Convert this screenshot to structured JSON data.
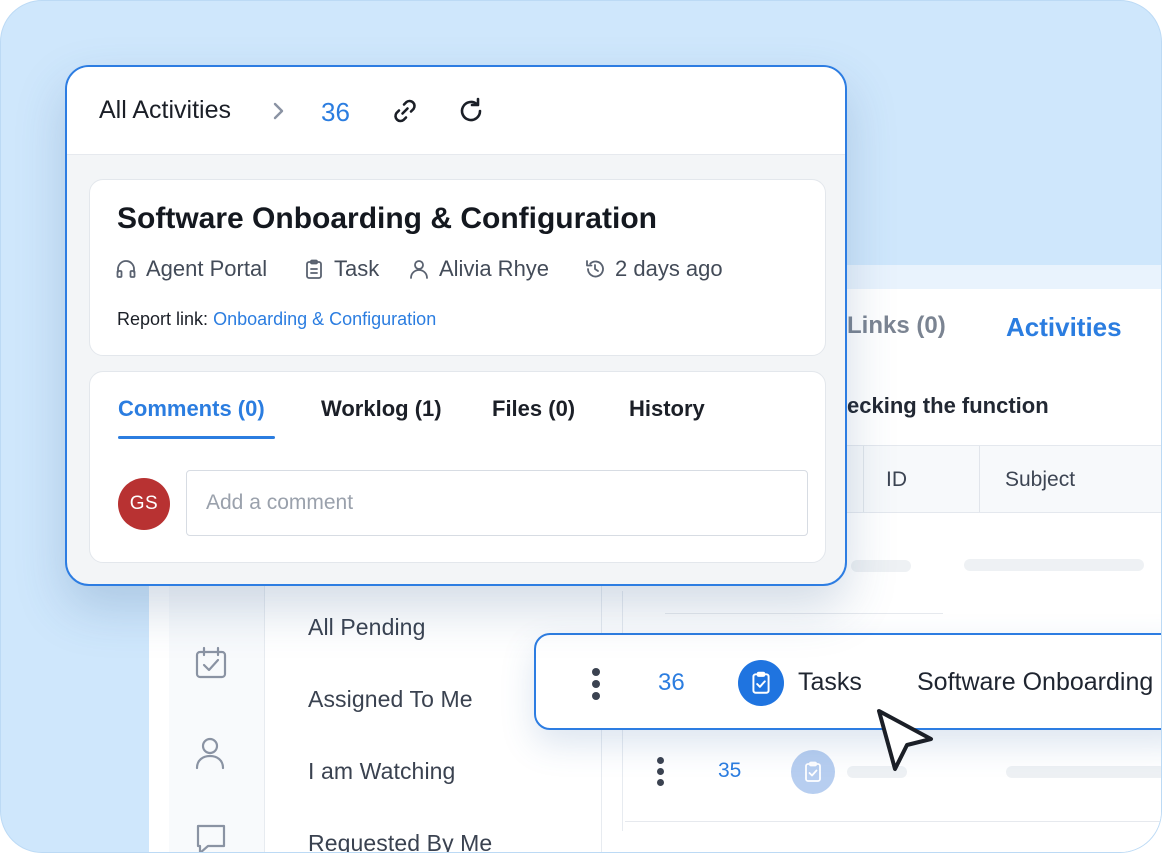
{
  "popup": {
    "breadcrumb": "All Activities",
    "activity_id": "36",
    "header_icons": [
      "link-icon",
      "refresh-icon"
    ],
    "title": "Software Onboarding & Configuration",
    "meta": {
      "portal": "Agent Portal",
      "type": "Task",
      "assignee": "Alivia Rhye",
      "time": "2 days ago"
    },
    "report_label": "Report link:",
    "report_link": "Onboarding & Configuration",
    "tabs": [
      "Comments (0)",
      "Worklog (1)",
      "Files (0)",
      "History"
    ],
    "active_tab": "Comments (0)",
    "avatar_initials": "GS",
    "comment_placeholder": "Add a comment"
  },
  "background": {
    "tabs": {
      "links": "Links (0)",
      "activities": "Activities"
    },
    "description": "ecking the function",
    "table_headers": [
      "ID",
      "Subject"
    ],
    "nav_items": [
      "All Pending",
      "Assigned To Me",
      "I am Watching",
      "Requested By Me"
    ],
    "rail_icons": [
      "calendar-check-icon",
      "user-icon",
      "chat-icon"
    ],
    "row_35_id": "35"
  },
  "task_row": {
    "id": "36",
    "type": "Tasks",
    "subject": "Software Onboarding"
  },
  "colors": {
    "accent": "#2b7de0",
    "background": "#cfe7fc",
    "avatar": "#b83232",
    "task_icon": "#1f74e0"
  }
}
